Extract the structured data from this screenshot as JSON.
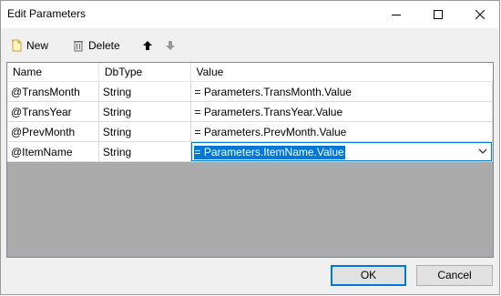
{
  "window": {
    "title": "Edit Parameters"
  },
  "window_controls": {
    "minimize": "minimize",
    "maximize": "maximize",
    "close": "close"
  },
  "toolbar": {
    "new_label": "New",
    "delete_label": "Delete"
  },
  "table": {
    "headers": [
      "Name",
      "DbType",
      "Value"
    ],
    "rows": [
      {
        "name": "@TransMonth",
        "dbtype": "String",
        "value": "= Parameters.TransMonth.Value"
      },
      {
        "name": "@TransYear",
        "dbtype": "String",
        "value": "= Parameters.TransYear.Value"
      },
      {
        "name": "@PrevMonth",
        "dbtype": "String",
        "value": "= Parameters.PrevMonth.Value"
      },
      {
        "name": "@ItemName",
        "dbtype": "String",
        "value": "= Parameters.ItemName.Value"
      }
    ],
    "selected_row": 3
  },
  "buttons": {
    "ok_label": "OK",
    "cancel_label": "Cancel"
  },
  "colors": {
    "accent": "#0078d7",
    "grid_empty": "#ababab",
    "button_face": "#e1e1e1"
  }
}
